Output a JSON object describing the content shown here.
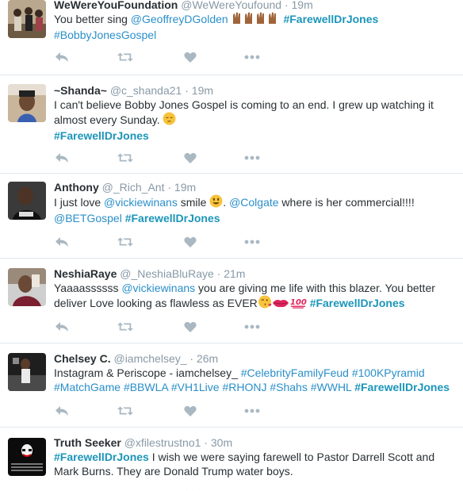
{
  "colors": {
    "accent": "#1b95b9",
    "muted": "#8899a6",
    "icon": "#aab8c2",
    "border": "#e1e8ed"
  },
  "icons": [
    "reply-icon",
    "retweet-icon",
    "like-icon",
    "more-icon"
  ],
  "tweets": [
    {
      "name": "WeWereYouFoundation",
      "handle": "@WeWereYoufound",
      "time": "19m",
      "segments": [
        {
          "t": "text",
          "v": "You better sing "
        },
        {
          "t": "mention",
          "v": "@GeoffreyDGolden"
        },
        {
          "t": "text",
          "v": " "
        },
        {
          "t": "emoji",
          "v": "raised-hands-emoji"
        },
        {
          "t": "text",
          "v": " "
        },
        {
          "t": "hashtag",
          "v": "#FarewellDrJones"
        },
        {
          "t": "br"
        },
        {
          "t": "mention",
          "v": "#BobbyJonesGospel"
        }
      ]
    },
    {
      "name": "~Shanda~",
      "handle": "@c_shanda21",
      "time": "19m",
      "segments": [
        {
          "t": "text",
          "v": "I can't believe Bobby Jones Gospel is coming to an end. I grew up watching it almost every Sunday. "
        },
        {
          "t": "emoji",
          "v": "pensive-face-emoji"
        },
        {
          "t": "br"
        },
        {
          "t": "hashtag",
          "v": "#FarewellDrJones"
        }
      ]
    },
    {
      "name": "Anthony",
      "handle": "@_Rich_Ant",
      "time": "19m",
      "segments": [
        {
          "t": "text",
          "v": "I just love "
        },
        {
          "t": "mention",
          "v": "@vickiewinans"
        },
        {
          "t": "text",
          "v": " smile "
        },
        {
          "t": "emoji",
          "v": "smiley-emoji"
        },
        {
          "t": "text",
          "v": ". "
        },
        {
          "t": "mention",
          "v": "@Colgate"
        },
        {
          "t": "text",
          "v": " where is her commercial!!!!"
        },
        {
          "t": "br"
        },
        {
          "t": "mention",
          "v": "@BETGospel"
        },
        {
          "t": "text",
          "v": " "
        },
        {
          "t": "hashtag",
          "v": "#FarewellDrJones"
        }
      ]
    },
    {
      "name": "NeshiaRaye",
      "handle": "@_NeshiaBluRaye",
      "time": "21m",
      "segments": [
        {
          "t": "text",
          "v": "Yaaaassssss "
        },
        {
          "t": "mention",
          "v": "@vickiewinans"
        },
        {
          "t": "text",
          "v": " you are giving me life with this blazer. You better deliver Love looking as flawless as EVER"
        },
        {
          "t": "emoji",
          "v": "kiss-face-emoji"
        },
        {
          "t": "emoji",
          "v": "kiss-lips-emoji"
        },
        {
          "t": "emoji",
          "v": "hundred-emoji"
        },
        {
          "t": "text",
          "v": " "
        },
        {
          "t": "hashtag",
          "v": "#FarewellDrJones"
        }
      ]
    },
    {
      "name": "Chelsey C.",
      "handle": "@iamchelsey_",
      "time": "26m",
      "segments": [
        {
          "t": "text",
          "v": "Instagram & Periscope - iamchelsey_ "
        },
        {
          "t": "mention",
          "v": "#CelebrityFamilyFeud"
        },
        {
          "t": "text",
          "v": " "
        },
        {
          "t": "mention",
          "v": "#100KPyramid"
        },
        {
          "t": "br"
        },
        {
          "t": "mention",
          "v": "#MatchGame"
        },
        {
          "t": "text",
          "v": " "
        },
        {
          "t": "mention",
          "v": "#BBWLA"
        },
        {
          "t": "text",
          "v": " "
        },
        {
          "t": "mention",
          "v": "#VH1Live"
        },
        {
          "t": "text",
          "v": " "
        },
        {
          "t": "mention",
          "v": "#RHONJ"
        },
        {
          "t": "text",
          "v": " "
        },
        {
          "t": "mention",
          "v": "#Shahs"
        },
        {
          "t": "text",
          "v": " "
        },
        {
          "t": "mention",
          "v": "#WWHL"
        },
        {
          "t": "text",
          "v": " "
        },
        {
          "t": "hashtag",
          "v": "#FarewellDrJones"
        }
      ]
    },
    {
      "name": "Truth Seeker",
      "handle": "@xfilestrustno1",
      "time": "30m",
      "segments": [
        {
          "t": "hashtag",
          "v": "#FarewellDrJones"
        },
        {
          "t": "text",
          "v": " I wish we were saying farewell to Pastor Darrell Scott and Mark Burns. They are Donald Trump water boys."
        }
      ]
    }
  ]
}
